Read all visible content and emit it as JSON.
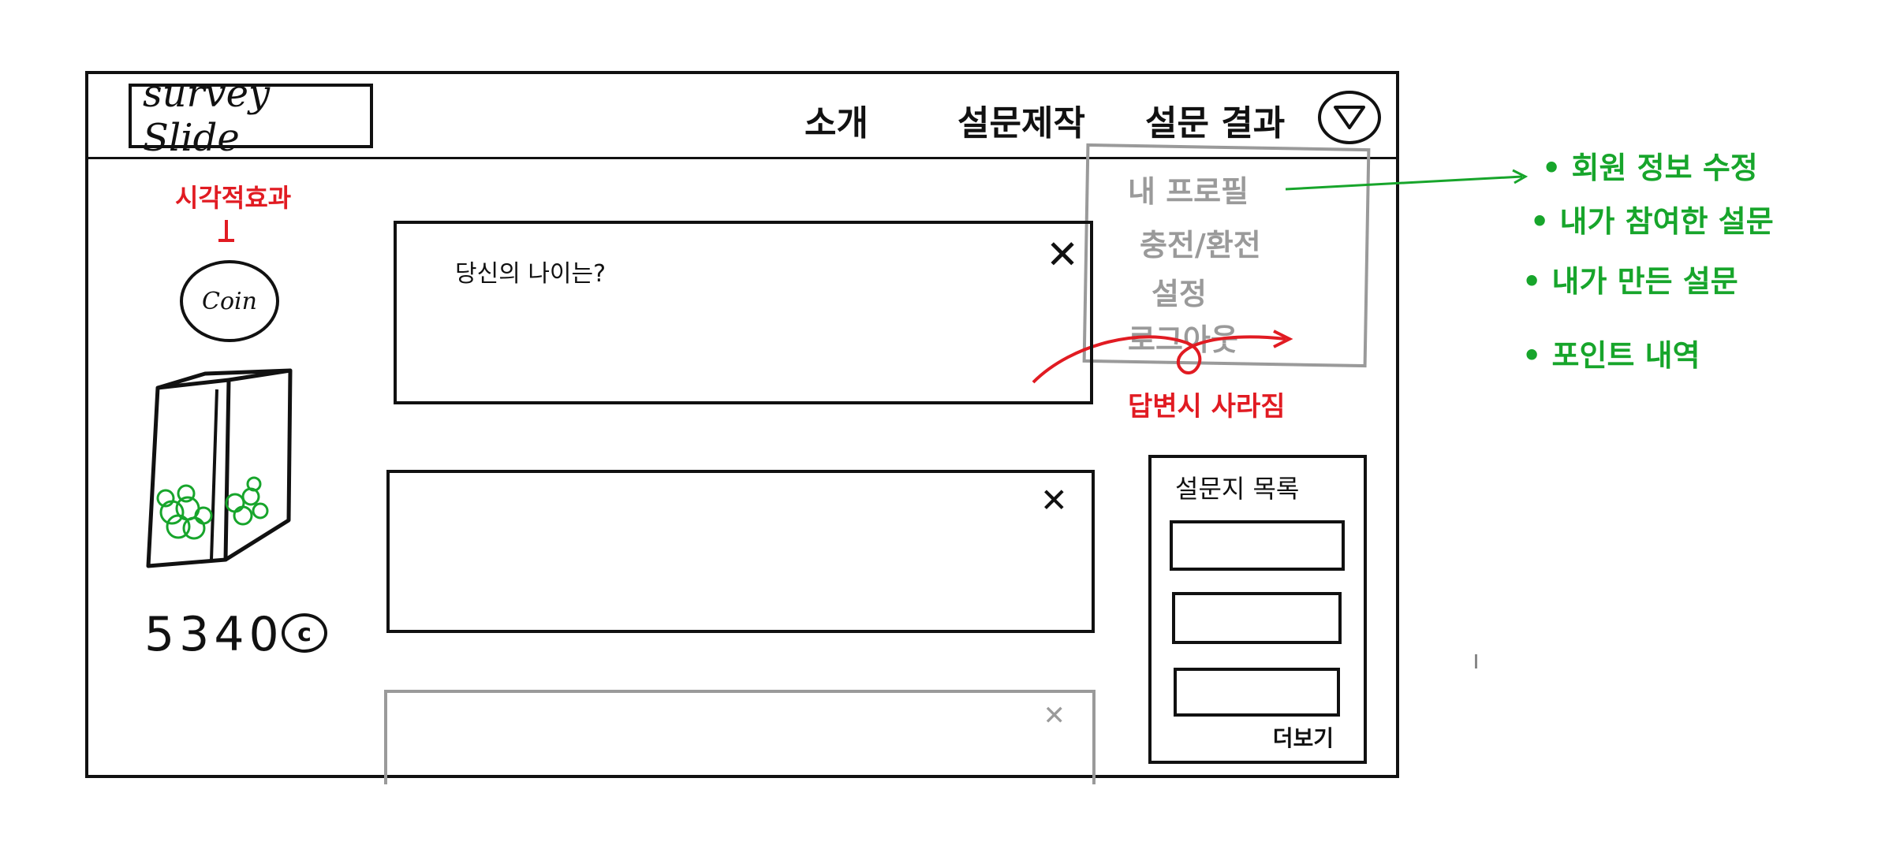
{
  "header": {
    "logo": "survey Slide",
    "nav": [
      "소개",
      "설문제작",
      "설문 결과"
    ],
    "profile_icon": "triangle-play-icon"
  },
  "dropdown": {
    "items": [
      "내 프로필",
      "충전/환전",
      "설정",
      "로그아웃"
    ]
  },
  "annotations": {
    "visual_effect": "시각적효과",
    "disappear_on_answer": "답변시 사라짐",
    "profile_menu": [
      "• 회원 정보 수정",
      "• 내가 참여한 설문",
      "• 내가 만든 설문",
      "• 포인트 내역"
    ]
  },
  "sidebar": {
    "coin_label": "Coin",
    "coin_balance": "5340",
    "coin_unit": "c"
  },
  "cards": {
    "card1_question": "당신의 나이는?",
    "close": "✕"
  },
  "survey_list": {
    "title": "설문지 목록",
    "more": "더보기"
  },
  "colors": {
    "ink": "#111111",
    "gray": "#9a9a9a",
    "red_annotation": "#e11b22",
    "green_annotation": "#17a52b"
  }
}
